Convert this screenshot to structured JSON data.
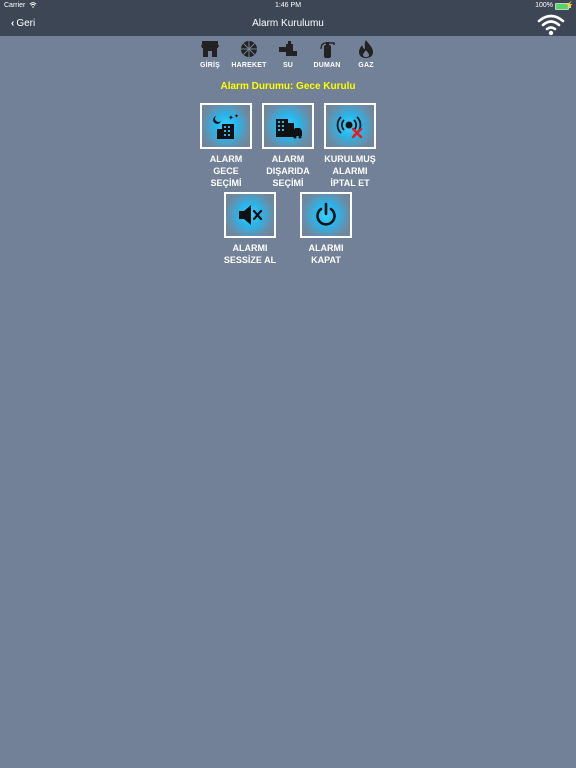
{
  "status_bar": {
    "carrier": "Carrier",
    "time": "1:46 PM",
    "battery": "100%",
    "battery_level": 1.0
  },
  "nav": {
    "back_label": "Geri",
    "title": "Alarm Kurulumu"
  },
  "sensors": [
    {
      "label": "GİRİŞ",
      "icon": "store-icon"
    },
    {
      "label": "HAREKET",
      "icon": "motion-sensor-icon"
    },
    {
      "label": "SU",
      "icon": "water-valve-icon"
    },
    {
      "label": "DUMAN",
      "icon": "fire-extinguisher-icon"
    },
    {
      "label": "GAZ",
      "icon": "flame-icon"
    }
  ],
  "alarm_status": "Alarm Durumu: Gece Kurulu",
  "actions": [
    {
      "label": "ALARM\nGECE\nSEÇİMİ",
      "icon": "night-building-icon"
    },
    {
      "label": "ALARM\nDIŞARIDA\nSEÇİMİ",
      "icon": "building-car-icon"
    },
    {
      "label": "KURULMUŞ\nALARMI\nİPTAL ET",
      "icon": "alarm-cancel-icon"
    },
    {
      "label": "ALARMI\nSESSİZE AL",
      "icon": "mute-icon"
    },
    {
      "label": "ALARMI\nKAPAT",
      "icon": "power-icon"
    }
  ],
  "colors": {
    "background": "#728197",
    "bar": "#3d4654",
    "status_text": "#ffff00",
    "accent": "#2ab4ea"
  }
}
